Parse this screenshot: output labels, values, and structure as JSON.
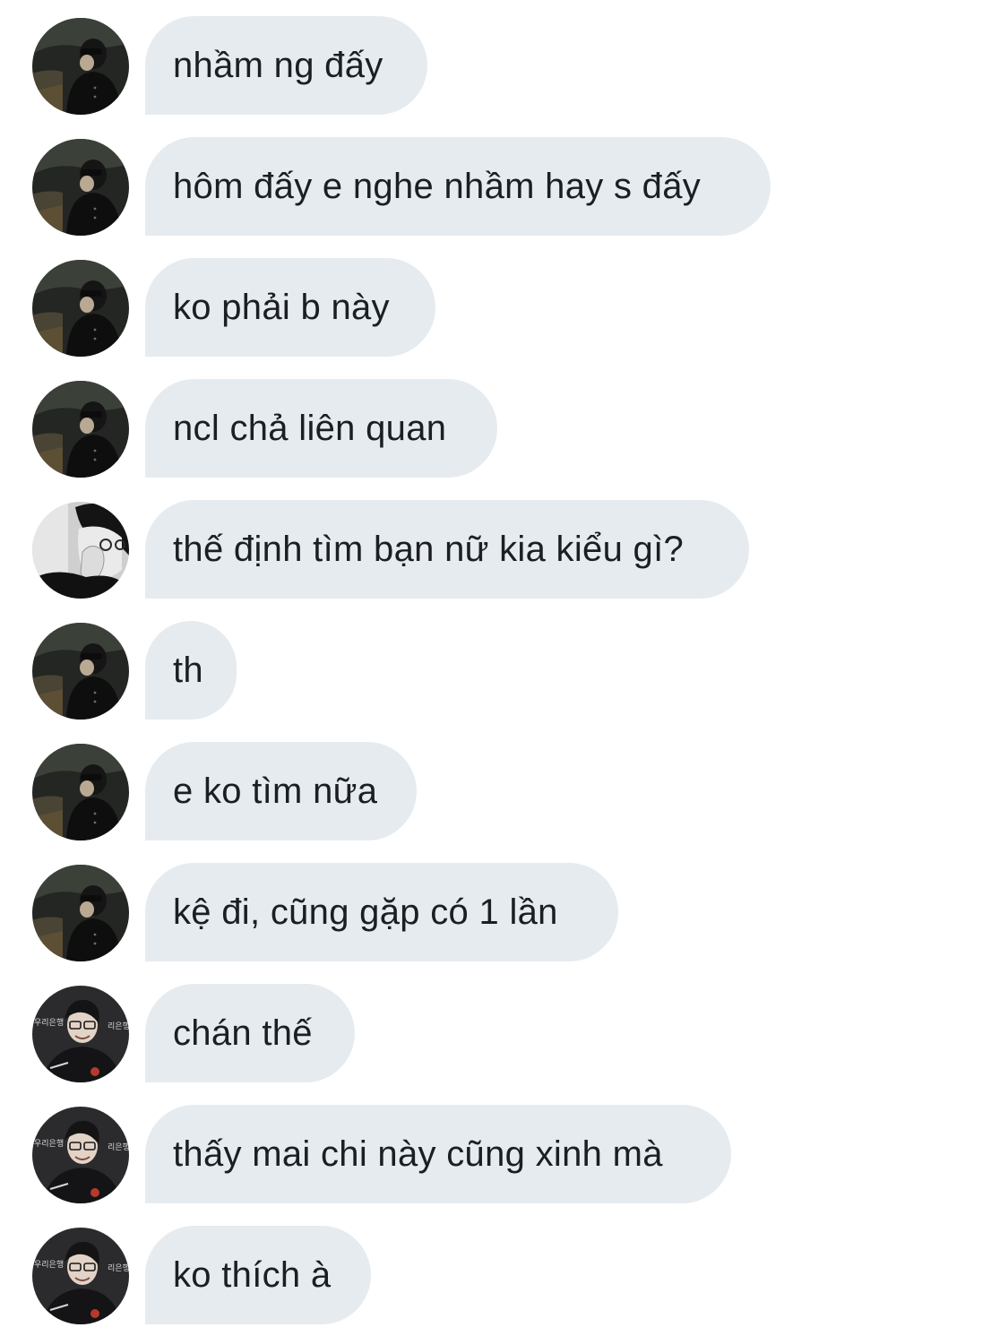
{
  "conversation": {
    "messages": [
      {
        "sender": "A",
        "text": "nhầm ng đấy"
      },
      {
        "sender": "A",
        "text": "hôm đấy e nghe nhầm hay s đấy"
      },
      {
        "sender": "A",
        "text": "ko phải b này"
      },
      {
        "sender": "A",
        "text": "ncl chả liên quan"
      },
      {
        "sender": "B",
        "text": "thế định tìm bạn nữ kia kiểu gì?"
      },
      {
        "sender": "A",
        "text": "th"
      },
      {
        "sender": "A",
        "text": "e ko tìm nữa"
      },
      {
        "sender": "A",
        "text": "kệ đi, cũng gặp có 1 lần"
      },
      {
        "sender": "C",
        "text": "chán thế"
      },
      {
        "sender": "C",
        "text": "thấy mai chi này cũng xinh mà"
      },
      {
        "sender": "C",
        "text": "ko thích à"
      }
    ]
  },
  "avatars": {
    "A": {
      "icon": "dark-selfie-avatar-icon"
    },
    "B": {
      "icon": "grayscale-portrait-avatar-icon"
    },
    "C": {
      "icon": "interview-backdrop-avatar-icon",
      "backdrop_text": [
        "우리은행",
        "리은행"
      ]
    }
  },
  "colors": {
    "bubble_background": "#e6ebf0",
    "text": "#1b1f24",
    "page_background": "#ffffff"
  }
}
